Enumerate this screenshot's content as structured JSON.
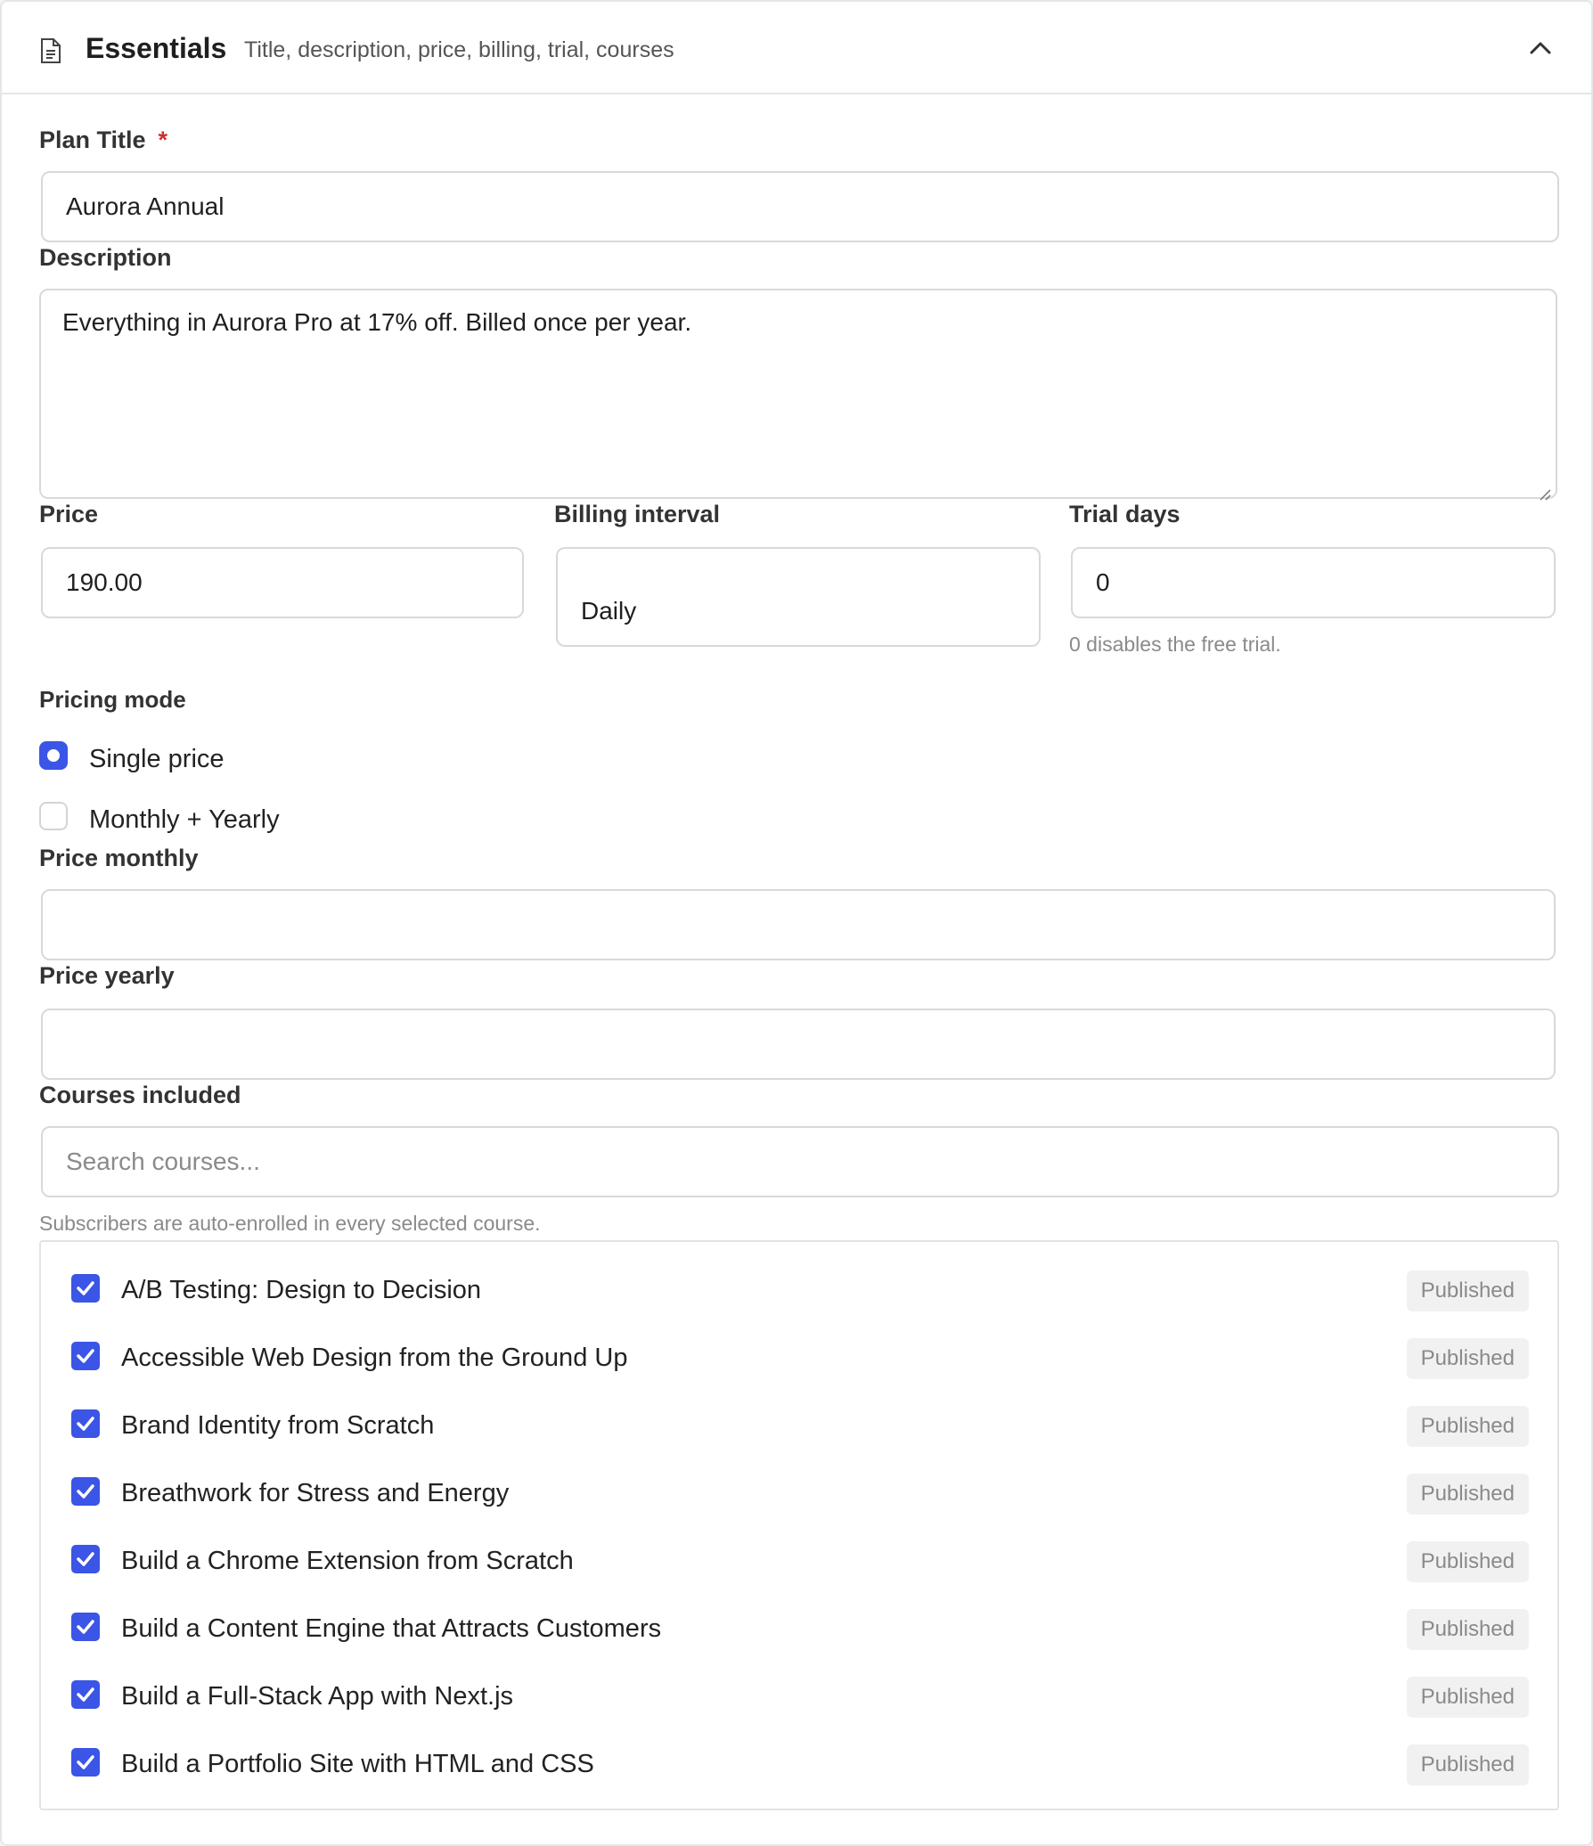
{
  "section": {
    "title": "Essentials",
    "subtitle": "Title, description, price, billing, trial, courses",
    "icon": "document-icon",
    "toggle_icon": "chevron-up-icon"
  },
  "plan_title": {
    "label": "Plan Title",
    "required_mark": "*",
    "value": "Aurora Annual"
  },
  "description": {
    "label": "Description",
    "value": "Everything in Aurora Pro at 17% off. Billed once per year."
  },
  "price": {
    "label": "Price",
    "value": "190.00"
  },
  "billing_interval": {
    "label": "Billing interval",
    "value": "Daily"
  },
  "trial_days": {
    "label": "Trial days",
    "value": "0",
    "help": "0 disables the free trial."
  },
  "pricing_mode": {
    "label": "Pricing mode",
    "options": [
      {
        "label": "Single price",
        "selected": true
      },
      {
        "label": "Monthly + Yearly",
        "selected": false
      }
    ]
  },
  "price_monthly": {
    "label": "Price monthly",
    "value": ""
  },
  "price_yearly": {
    "label": "Price yearly",
    "value": ""
  },
  "courses": {
    "label": "Courses included",
    "search_placeholder": "Search courses...",
    "help": "Subscribers are auto-enrolled in every selected course.",
    "items": [
      {
        "name": "A/B Testing: Design to Decision",
        "status": "Published",
        "checked": true
      },
      {
        "name": "Accessible Web Design from the Ground Up",
        "status": "Published",
        "checked": true
      },
      {
        "name": "Brand Identity from Scratch",
        "status": "Published",
        "checked": true
      },
      {
        "name": "Breathwork for Stress and Energy",
        "status": "Published",
        "checked": true
      },
      {
        "name": "Build a Chrome Extension from Scratch",
        "status": "Published",
        "checked": true
      },
      {
        "name": "Build a Content Engine that Attracts Customers",
        "status": "Published",
        "checked": true
      },
      {
        "name": "Build a Full-Stack App with Next.js",
        "status": "Published",
        "checked": true
      },
      {
        "name": "Build a Portfolio Site with HTML and CSS",
        "status": "Published",
        "checked": true
      }
    ]
  },
  "colors": {
    "accent": "#3b55e6",
    "required": "#d22c2c",
    "border": "#d9d9d9",
    "muted_text": "#8a8a8a"
  }
}
